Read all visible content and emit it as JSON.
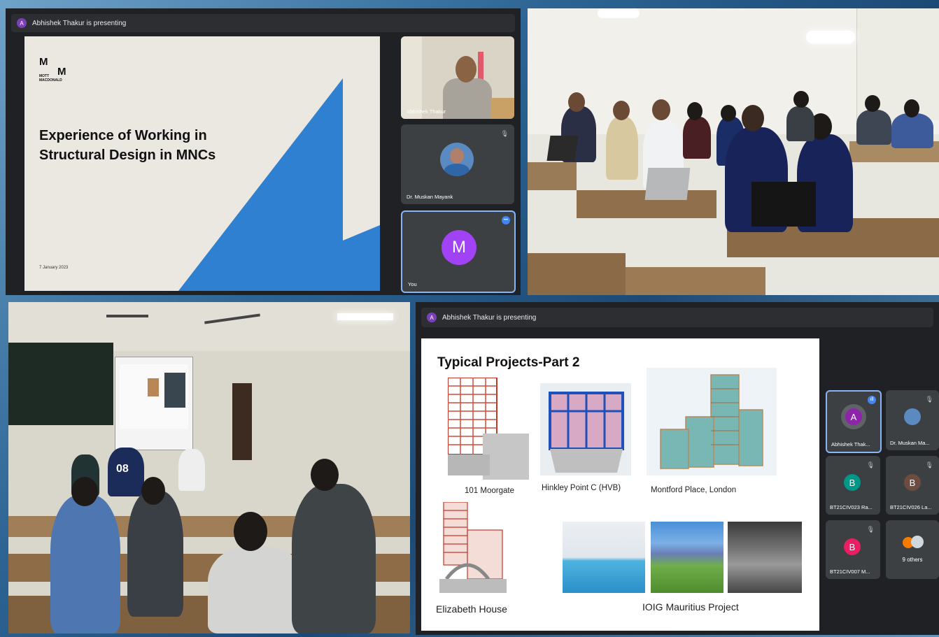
{
  "meet_top": {
    "presenting_initial": "A",
    "presenting_text": "Abhishek Thakur is presenting",
    "slide": {
      "logo_line1": "M",
      "logo_line2_left": "MOTT\nMACDONALD",
      "logo_line2_right": "M",
      "title": "Experience of Working in Structural Design in MNCs",
      "date": "7 January 2023"
    },
    "tiles": [
      {
        "name": "Abhishek Thakur"
      },
      {
        "name": "Dr. Muskan Mayank"
      },
      {
        "name": "You",
        "initial": "M",
        "color": "#a142f4"
      }
    ]
  },
  "meet_bottom": {
    "presenting_initial": "A",
    "presenting_text": "Abhishek Thakur is presenting",
    "slide": {
      "title": "Typical Projects-Part 2",
      "captions": [
        "101 Moorgate",
        "Hinkley Point C (HVB)",
        "Montford Place, London",
        "Elizabeth House",
        "IOIG Mauritius Project"
      ]
    },
    "tiles": [
      {
        "name": "Abhishek Thak...",
        "initial": "A",
        "color": "#8e24aa"
      },
      {
        "name": "Dr. Muskan Ma..."
      },
      {
        "name": "BT21CIV023 Ra...",
        "initial": "B",
        "color": "#009688"
      },
      {
        "name": "BT21CIV026 La...",
        "initial": "B",
        "color": "#6d4c41"
      },
      {
        "name": "BT21CIV007 M...",
        "initial": "B",
        "color": "#e91e63"
      },
      {
        "name": "9 others"
      }
    ]
  },
  "classroom_photo": {
    "jersey_number": "08"
  }
}
